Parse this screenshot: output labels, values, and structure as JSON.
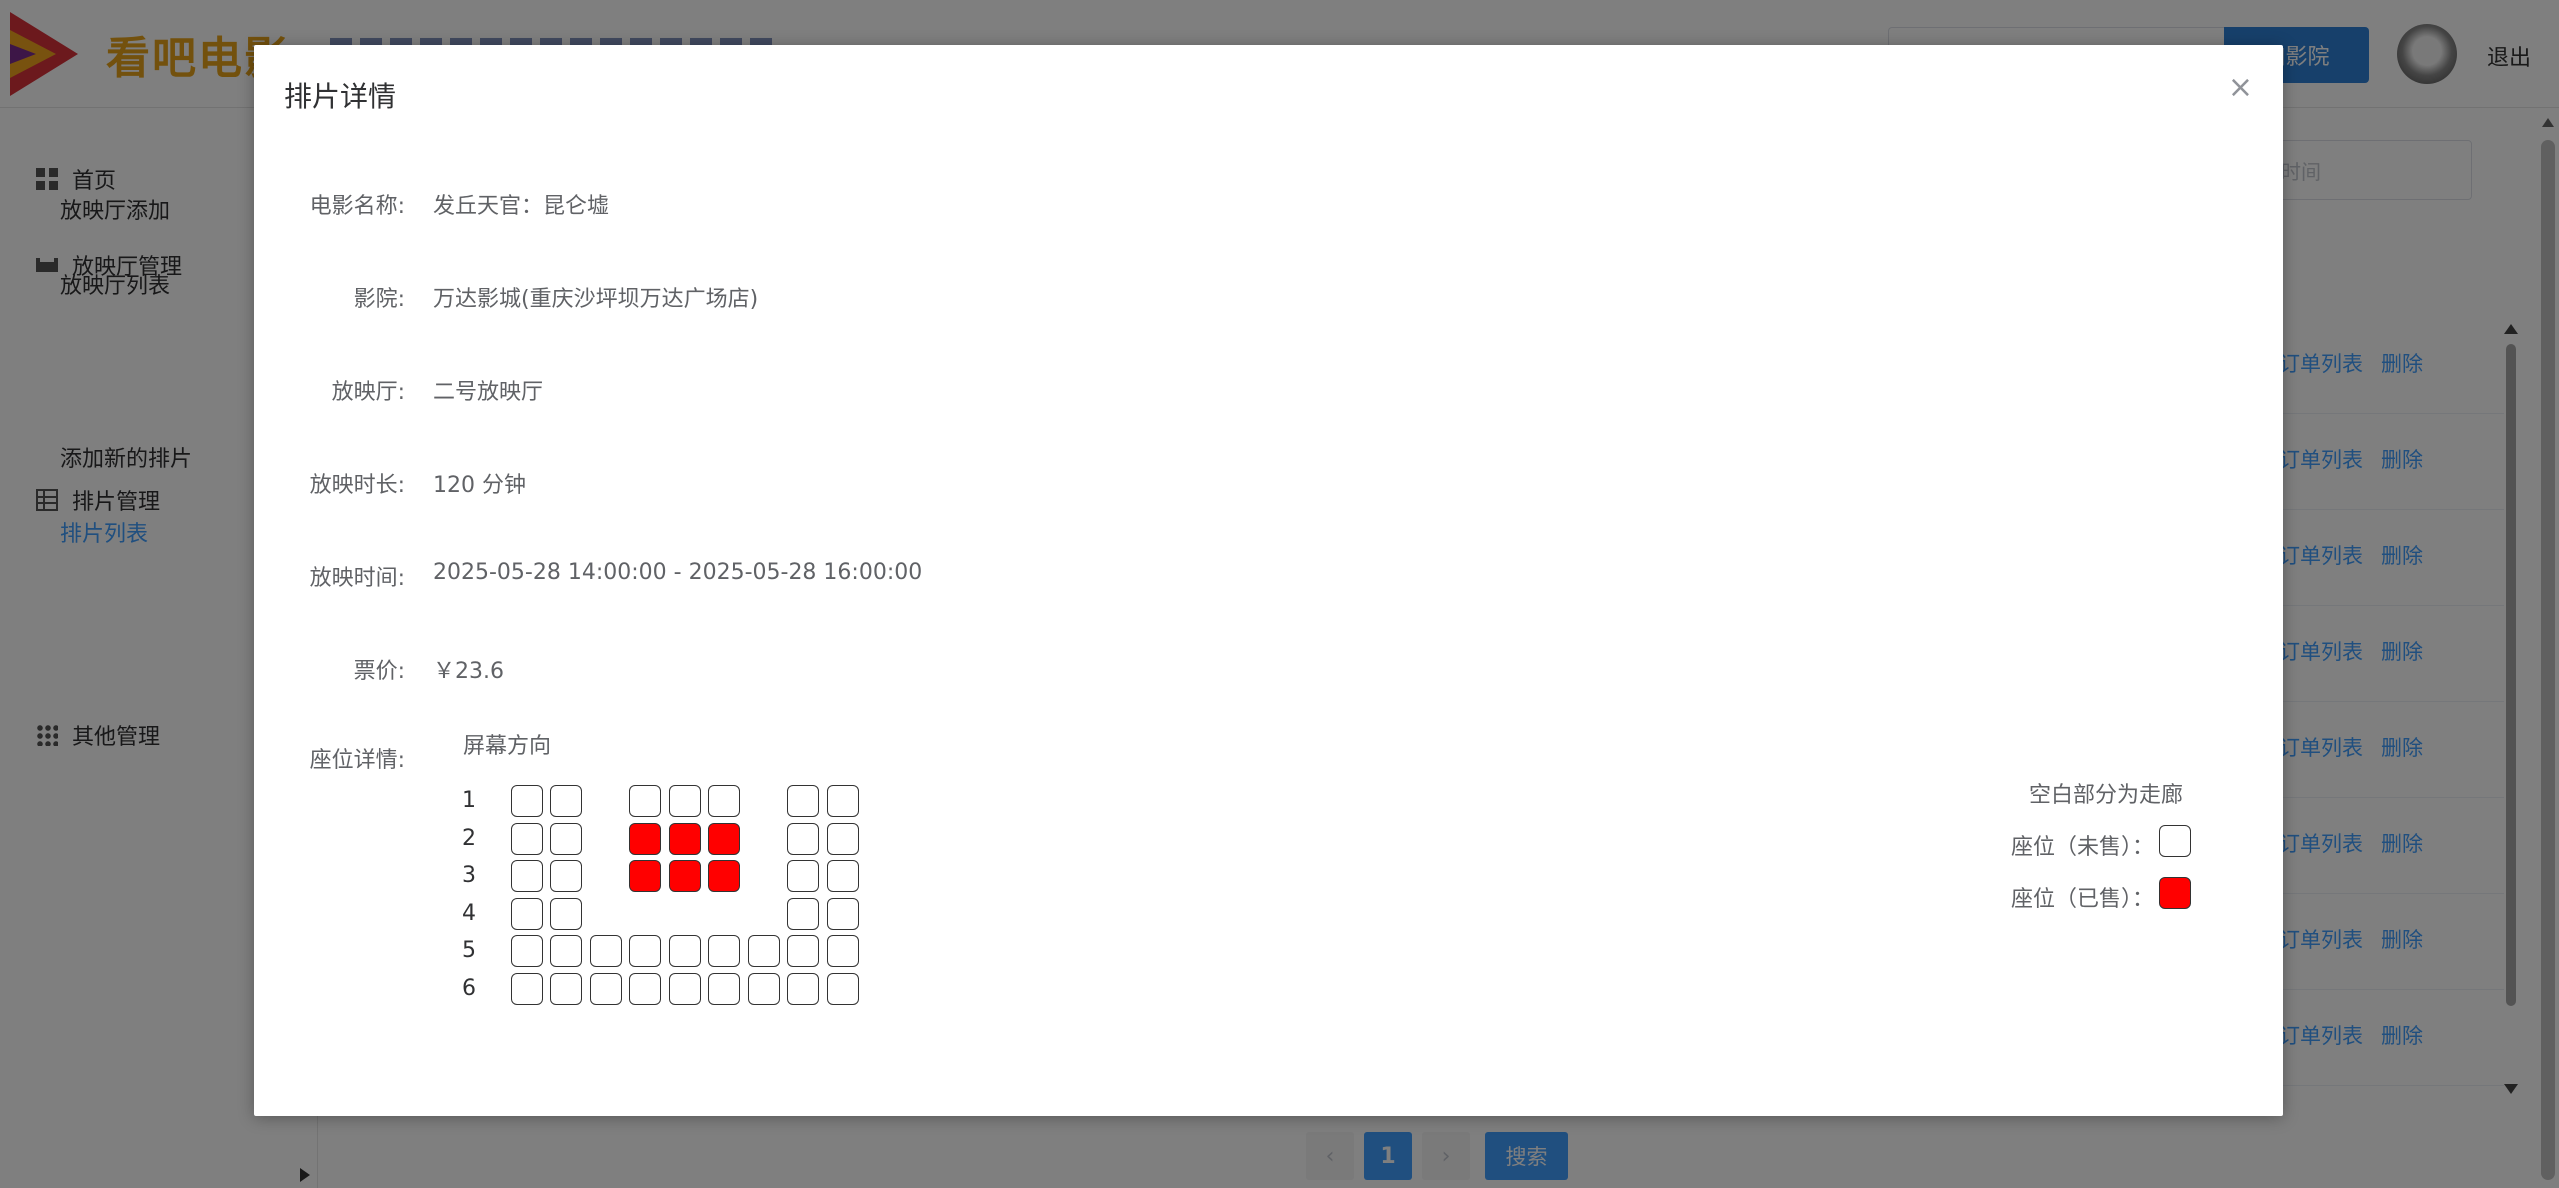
{
  "header": {
    "logo_text": "看吧电影",
    "search_button": "加影院",
    "logout": "退出"
  },
  "sidebar": {
    "items": [
      {
        "label": "首页",
        "icon": "grid-icon"
      },
      {
        "label": "放映厅管理",
        "icon": "couch-icon"
      },
      {
        "label": "排片管理",
        "icon": "table-icon"
      },
      {
        "label": "其他管理",
        "icon": "dots-icon"
      }
    ],
    "subitems": [
      {
        "label": "放映厅添加"
      },
      {
        "label": "放映厅列表"
      },
      {
        "label": "添加新的排片"
      },
      {
        "label": "排片列表",
        "active": true
      }
    ]
  },
  "main": {
    "date_placeholder": "时间",
    "rows": [
      {
        "link1": "订单列表",
        "link2": "删除"
      },
      {
        "link1": "订单列表",
        "link2": "删除"
      },
      {
        "link1": "订单列表",
        "link2": "删除"
      },
      {
        "link1": "订单列表",
        "link2": "删除"
      },
      {
        "link1": "订单列表",
        "link2": "删除"
      },
      {
        "link1": "订单列表",
        "link2": "删除"
      },
      {
        "link1": "订单列表",
        "link2": "删除"
      },
      {
        "link1": "订单列表",
        "link2": "删除"
      }
    ],
    "pagination": {
      "prev": "‹",
      "current": "1",
      "next": "›",
      "search": "搜索"
    }
  },
  "dialog": {
    "title": "排片详情",
    "close": "×",
    "fields": [
      {
        "label": "电影名称:",
        "value": "发丘天官：昆仑墟"
      },
      {
        "label": "影院:",
        "value": "万达影城(重庆沙坪坝万达广场店)"
      },
      {
        "label": "放映厅:",
        "value": "二号放映厅"
      },
      {
        "label": "放映时长:",
        "value": "120 分钟"
      },
      {
        "label": "放映时间:",
        "value": "2025-05-28 14:00:00 - 2025-05-28 16:00:00"
      },
      {
        "label": "票价:",
        "value": "￥23.6"
      }
    ],
    "seat_label": "座位详情:",
    "screen_direction": "屏幕方向",
    "seat_rows": [
      {
        "label": "1",
        "seats": [
          1,
          1,
          0,
          1,
          1,
          1,
          0,
          1,
          1
        ]
      },
      {
        "label": "2",
        "seats": [
          1,
          1,
          0,
          2,
          2,
          2,
          0,
          1,
          1
        ]
      },
      {
        "label": "3",
        "seats": [
          1,
          1,
          0,
          2,
          2,
          2,
          0,
          1,
          1
        ]
      },
      {
        "label": "4",
        "seats": [
          1,
          1,
          0,
          0,
          0,
          0,
          0,
          1,
          1
        ]
      },
      {
        "label": "5",
        "seats": [
          1,
          1,
          1,
          1,
          1,
          1,
          1,
          1,
          1
        ]
      },
      {
        "label": "6",
        "seats": [
          1,
          1,
          1,
          1,
          1,
          1,
          1,
          1,
          1
        ]
      }
    ],
    "legend": {
      "aisle_note": "空白部分为走廊",
      "unsold": "座位（未售）：",
      "sold": "座位（已售）："
    },
    "colors": {
      "sold": "#ff0000",
      "accent": "#409eff"
    }
  }
}
